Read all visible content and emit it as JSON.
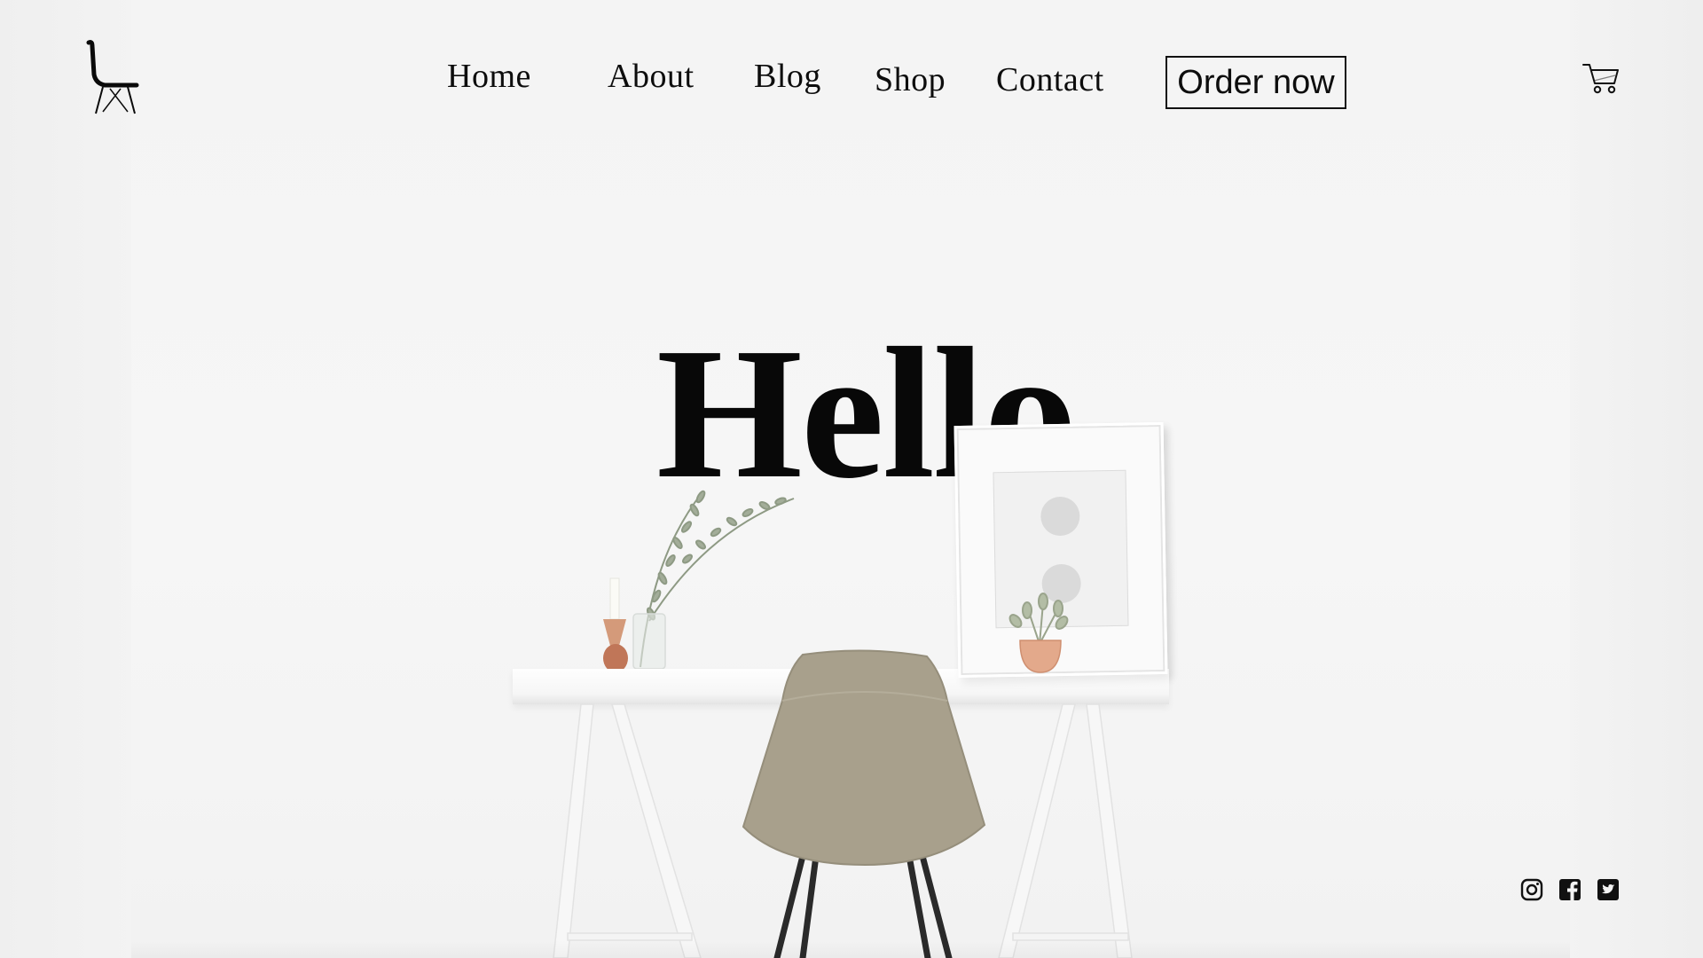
{
  "header": {
    "nav": [
      {
        "id": "home",
        "label": "Home"
      },
      {
        "id": "about",
        "label": "About"
      },
      {
        "id": "blog",
        "label": "Blog"
      },
      {
        "id": "shop",
        "label": "Shop"
      },
      {
        "id": "contact",
        "label": "Contact"
      }
    ],
    "order_label": "Order now",
    "logo_icon": "chair-icon",
    "cart_icon": "shopping-cart-icon"
  },
  "hero": {
    "title": "Hello"
  },
  "social": [
    {
      "icon": "instagram-icon"
    },
    {
      "icon": "facebook-icon"
    },
    {
      "icon": "twitter-icon"
    }
  ],
  "colors": {
    "background": "#f4f4f4",
    "text": "#0d0d0d",
    "chair": "#a8a08c",
    "accent_copper": "#d49a7a"
  }
}
